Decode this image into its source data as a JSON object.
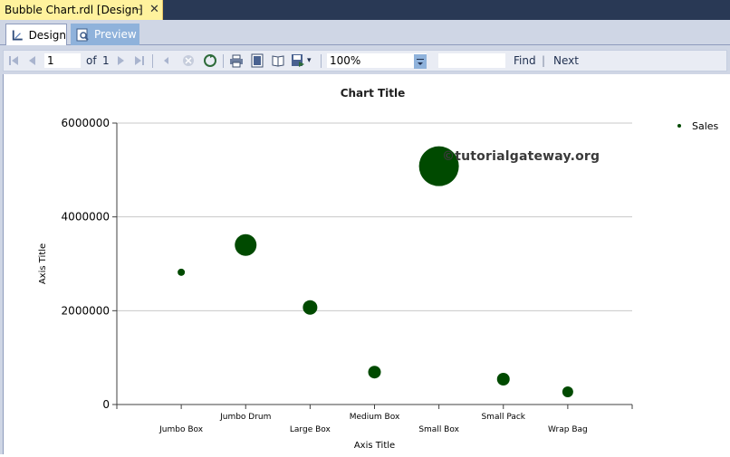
{
  "document_tab": {
    "title": "Bubble Chart.rdl [Design]",
    "pin": "⊣",
    "close": "✕"
  },
  "view_tabs": [
    {
      "label": "Design"
    },
    {
      "label": "Preview"
    }
  ],
  "toolbar": {
    "page_current": "1",
    "of_label": "of",
    "page_total": "1",
    "zoom": "100%",
    "find_label": "Find",
    "find_sep": "|",
    "next_label": "Next"
  },
  "watermark": "©tutorialgateway.org",
  "chart_data": {
    "type": "scatter",
    "subtype": "bubble",
    "title": "Chart Title",
    "xlabel": "Axis Title",
    "ylabel": "Axis Title",
    "categories": [
      "Jumbo Box",
      "Jumbo Drum",
      "Large Box",
      "Medium Box",
      "Small Box",
      "Small Pack",
      "Wrap Bag"
    ],
    "series": [
      {
        "name": "Sales",
        "color": "#004A00",
        "values": [
          2820000,
          3400000,
          2070000,
          690000,
          5080000,
          540000,
          270000
        ],
        "bubble_size": [
          4,
          12,
          8,
          7,
          22,
          7,
          6
        ]
      }
    ],
    "yticks": [
      "0",
      "2000000",
      "4000000",
      "6000000"
    ],
    "ylim": [
      0,
      6000000
    ],
    "grid": true,
    "legend_position": "top-right"
  }
}
